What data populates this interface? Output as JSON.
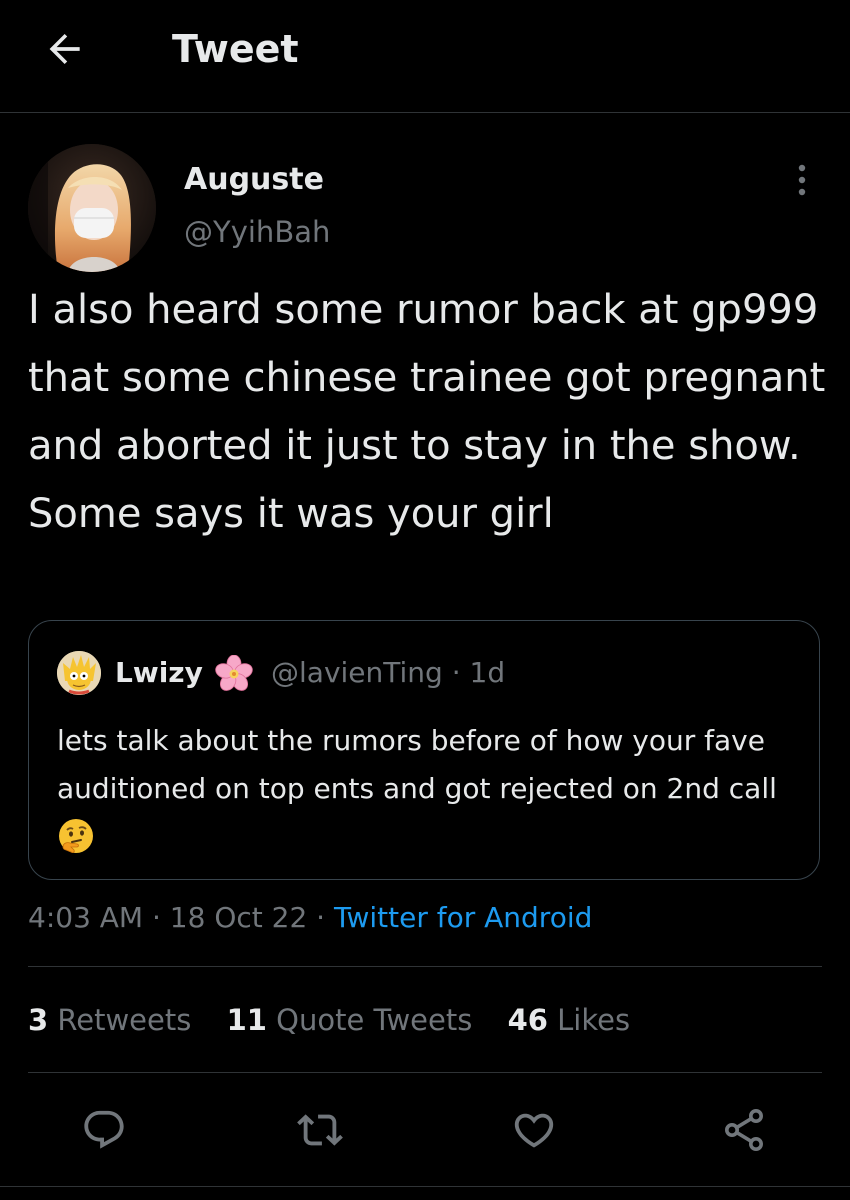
{
  "header": {
    "title": "Tweet",
    "back_icon": "arrow-left-icon"
  },
  "tweet": {
    "author_name": "Auguste",
    "author_handle": "@YyihBah",
    "more_icon": "more-vertical-icon",
    "text": "I also heard some rumor back at gp999 that some chinese trainee got pregnant and aborted it just to stay in the show. Some says it was your girl",
    "time": "4:03 AM",
    "date": "18 Oct 22",
    "separator": " · ",
    "source": "Twitter for Android"
  },
  "quote": {
    "name": "Lwizy",
    "name_emoji": "cherry-blossom",
    "handle_line": "@lavienTing · 1d",
    "text": "lets talk about the rumors before of how your fave auditioned on top ents and got rejected on 2nd call",
    "end_emoji": "thinking-face"
  },
  "stats": {
    "retweets_count": "3",
    "retweets_label": " Retweets",
    "quotes_count": "11",
    "quotes_label": " Quote Tweets",
    "likes_count": "46",
    "likes_label": " Likes"
  },
  "actions": {
    "reply_icon": "reply-icon",
    "retweet_icon": "retweet-icon",
    "like_icon": "heart-icon",
    "share_icon": "share-icon"
  },
  "colors": {
    "background": "#000000",
    "text": "#e7e9ea",
    "secondary": "#71767b",
    "link": "#1d9bf0",
    "border": "#2f3336"
  }
}
